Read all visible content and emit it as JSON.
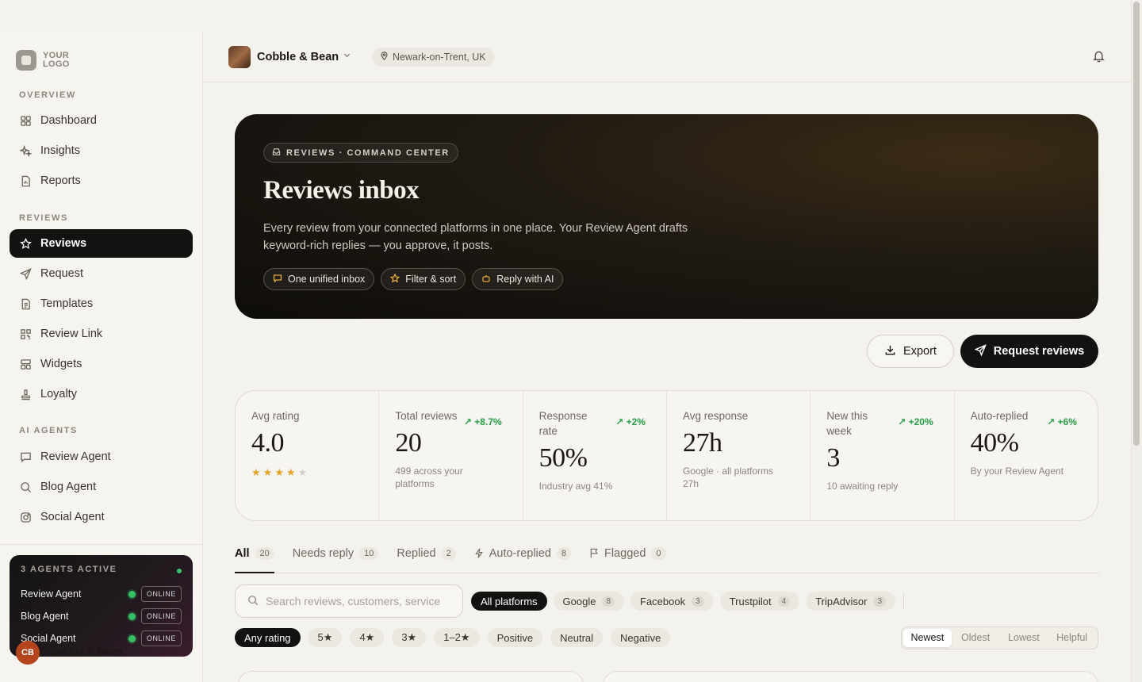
{
  "logo": {
    "line1": "YOUR",
    "line2": "LOGO"
  },
  "sidebar": {
    "sections": [
      {
        "label": "OVERVIEW",
        "items": [
          {
            "label": "Dashboard",
            "icon": "grid-icon"
          },
          {
            "label": "Insights",
            "icon": "sparkle-icon"
          },
          {
            "label": "Reports",
            "icon": "report-icon"
          }
        ]
      },
      {
        "label": "REVIEWS",
        "items": [
          {
            "label": "Reviews",
            "icon": "star-icon",
            "active": true
          },
          {
            "label": "Request",
            "icon": "send-icon"
          },
          {
            "label": "Templates",
            "icon": "document-icon"
          },
          {
            "label": "Review Link",
            "icon": "qr-icon"
          },
          {
            "label": "Widgets",
            "icon": "widget-icon"
          },
          {
            "label": "Loyalty",
            "icon": "stamp-icon"
          }
        ]
      },
      {
        "label": "AI AGENTS",
        "items": [
          {
            "label": "Review Agent",
            "icon": "chat-icon"
          },
          {
            "label": "Blog Agent",
            "icon": "search-icon"
          },
          {
            "label": "Social Agent",
            "icon": "camera-icon"
          }
        ]
      }
    ],
    "agents_card": {
      "title": "3 AGENTS ACTIVE",
      "agents": [
        {
          "name": "Review Agent",
          "status": "ONLINE"
        },
        {
          "name": "Blog Agent",
          "status": "ONLINE"
        },
        {
          "name": "Social Agent",
          "status": "ONLINE"
        }
      ]
    },
    "user": {
      "initials": "CB",
      "name": "Cobble & Bean"
    }
  },
  "header": {
    "business_name": "Cobble & Bean",
    "location": "Newark-on-Trent, UK"
  },
  "hero": {
    "tag": "REVIEWS · COMMAND CENTER",
    "title": "Reviews inbox",
    "description": "Every review from your connected platforms in one place. Your Review Agent drafts keyword-rich replies — you approve, it posts.",
    "chips": [
      {
        "label": "One unified inbox",
        "icon": "chat-icon"
      },
      {
        "label": "Filter & sort",
        "icon": "star-icon"
      },
      {
        "label": "Reply with AI",
        "icon": "robot-icon"
      }
    ]
  },
  "actions": {
    "export": "Export",
    "request": "Request reviews"
  },
  "stats": [
    {
      "label": "Avg rating",
      "value": "4.0",
      "rating": 4,
      "rating_max": 5
    },
    {
      "label": "Total reviews",
      "value": "20",
      "delta": "+8.7%",
      "sub": "499 across your platforms"
    },
    {
      "label": "Response rate",
      "value": "50%",
      "delta": "+2%",
      "sub": "Industry avg 41%"
    },
    {
      "label": "Avg response",
      "value": "27h",
      "sub": "Google · all platforms 27h"
    },
    {
      "label": "New this week",
      "value": "3",
      "delta": "+20%",
      "sub": "10 awaiting reply"
    },
    {
      "label": "Auto-replied",
      "value": "40%",
      "delta": "+6%",
      "sub": "By your Review Agent"
    }
  ],
  "tabs": [
    {
      "label": "All",
      "count": "20",
      "active": true
    },
    {
      "label": "Needs reply",
      "count": "10"
    },
    {
      "label": "Replied",
      "count": "2"
    },
    {
      "label": "Auto-replied",
      "count": "8",
      "icon": "bolt-icon"
    },
    {
      "label": "Flagged",
      "count": "0",
      "icon": "flag-icon"
    }
  ],
  "search": {
    "placeholder": "Search reviews, customers, service"
  },
  "platforms": [
    {
      "label": "All platforms",
      "active": true
    },
    {
      "label": "Google",
      "count": "8"
    },
    {
      "label": "Facebook",
      "count": "3"
    },
    {
      "label": "Trustpilot",
      "count": "4"
    },
    {
      "label": "TripAdvisor",
      "count": "3"
    }
  ],
  "ratings": [
    {
      "label": "Any rating",
      "active": true
    },
    {
      "label": "5★"
    },
    {
      "label": "4★"
    },
    {
      "label": "3★"
    },
    {
      "label": "1–2★"
    },
    {
      "label": "Positive"
    },
    {
      "label": "Neutral"
    },
    {
      "label": "Negative"
    }
  ],
  "sort": [
    {
      "label": "Newest",
      "active": true
    },
    {
      "label": "Oldest"
    },
    {
      "label": "Lowest"
    },
    {
      "label": "Helpful"
    }
  ],
  "colors": {
    "accent_dark": "#141210",
    "positive_green": "#26a146",
    "star_gold": "#e6a427",
    "online_green": "#34c163"
  }
}
